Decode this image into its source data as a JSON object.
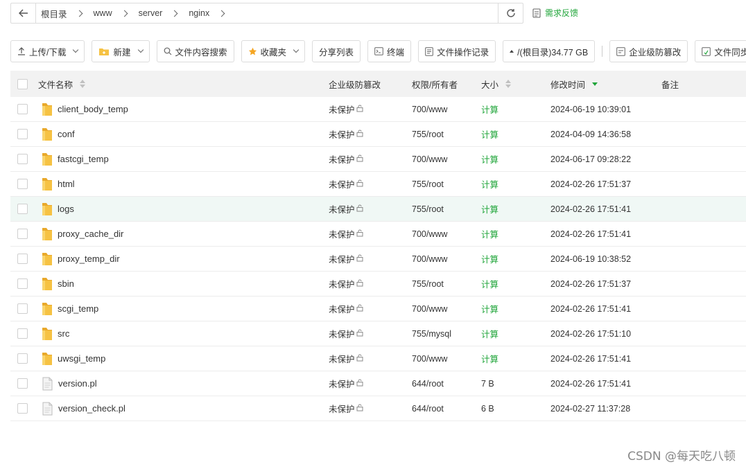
{
  "breadcrumb": {
    "items": [
      "根目录",
      "www",
      "server",
      "nginx"
    ]
  },
  "feedback_label": "需求反馈",
  "toolbar": {
    "upload": "上传/下载",
    "new": "新建",
    "content_search": "文件内容搜索",
    "favorites": "收藏夹",
    "share_list": "分享列表",
    "terminal": "终端",
    "ops_log": "文件操作记录",
    "disk": "/(根目录)34.77 GB",
    "tamper": "企业级防篡改",
    "sync": "文件同步"
  },
  "columns": {
    "name": "文件名称",
    "protect": "企业级防篡改",
    "perm": "权限/所有者",
    "size": "大小",
    "mtime": "修改时间",
    "note": "备注"
  },
  "rows": [
    {
      "name": "client_body_temp",
      "type": "folder",
      "protect": "未保护",
      "perm": "700/www",
      "size": "计算",
      "mtime": "2024-06-19 10:39:01"
    },
    {
      "name": "conf",
      "type": "folder",
      "protect": "未保护",
      "perm": "755/root",
      "size": "计算",
      "mtime": "2024-04-09 14:36:58"
    },
    {
      "name": "fastcgi_temp",
      "type": "folder",
      "protect": "未保护",
      "perm": "700/www",
      "size": "计算",
      "mtime": "2024-06-17 09:28:22"
    },
    {
      "name": "html",
      "type": "folder",
      "protect": "未保护",
      "perm": "755/root",
      "size": "计算",
      "mtime": "2024-02-26 17:51:37"
    },
    {
      "name": "logs",
      "type": "folder",
      "protect": "未保护",
      "perm": "755/root",
      "size": "计算",
      "mtime": "2024-02-26 17:51:41"
    },
    {
      "name": "proxy_cache_dir",
      "type": "folder",
      "protect": "未保护",
      "perm": "700/www",
      "size": "计算",
      "mtime": "2024-02-26 17:51:41"
    },
    {
      "name": "proxy_temp_dir",
      "type": "folder",
      "protect": "未保护",
      "perm": "700/www",
      "size": "计算",
      "mtime": "2024-06-19 10:38:52"
    },
    {
      "name": "sbin",
      "type": "folder",
      "protect": "未保护",
      "perm": "755/root",
      "size": "计算",
      "mtime": "2024-02-26 17:51:37"
    },
    {
      "name": "scgi_temp",
      "type": "folder",
      "protect": "未保护",
      "perm": "700/www",
      "size": "计算",
      "mtime": "2024-02-26 17:51:41"
    },
    {
      "name": "src",
      "type": "folder",
      "protect": "未保护",
      "perm": "755/mysql",
      "size": "计算",
      "mtime": "2024-02-26 17:51:10"
    },
    {
      "name": "uwsgi_temp",
      "type": "folder",
      "protect": "未保护",
      "perm": "700/www",
      "size": "计算",
      "mtime": "2024-02-26 17:51:41"
    },
    {
      "name": "version.pl",
      "type": "file",
      "protect": "未保护",
      "perm": "644/root",
      "size": "7 B",
      "mtime": "2024-02-26 17:51:41"
    },
    {
      "name": "version_check.pl",
      "type": "file",
      "protect": "未保护",
      "perm": "644/root",
      "size": "6 B",
      "mtime": "2024-02-27 11:37:28"
    }
  ],
  "highlighted_row": 4,
  "watermark": "CSDN @每天吃八顿",
  "colors": {
    "accent": "#20a53a",
    "folder": "#f6c243",
    "row_highlight": "#f0f8f5"
  }
}
